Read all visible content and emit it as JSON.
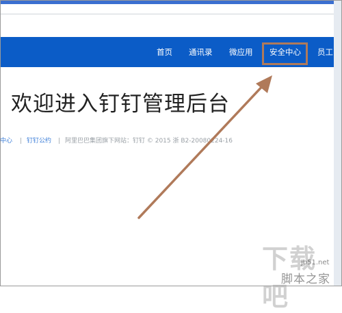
{
  "nav": {
    "items": [
      {
        "label": "首页"
      },
      {
        "label": "通讯录"
      },
      {
        "label": "微应用"
      },
      {
        "label": "安全中心"
      },
      {
        "label": "员工"
      }
    ]
  },
  "main": {
    "title": "欢迎进入钉钉管理后台"
  },
  "footer": {
    "link_help": "中心",
    "sep1": "|",
    "link_policy": "钉钉公约",
    "sep2": "|",
    "copyright": "阿里巴巴集团旗下网站：钉钉 © 2015 浙 B2-20080224-16"
  },
  "watermark": {
    "brand": "下载吧",
    "domain": "jb51.net",
    "name": "脚本之家"
  },
  "colors": {
    "navbar": "#0b5cc7",
    "highlight_box": "#b07a5a",
    "arrow": "#b07a5a"
  }
}
